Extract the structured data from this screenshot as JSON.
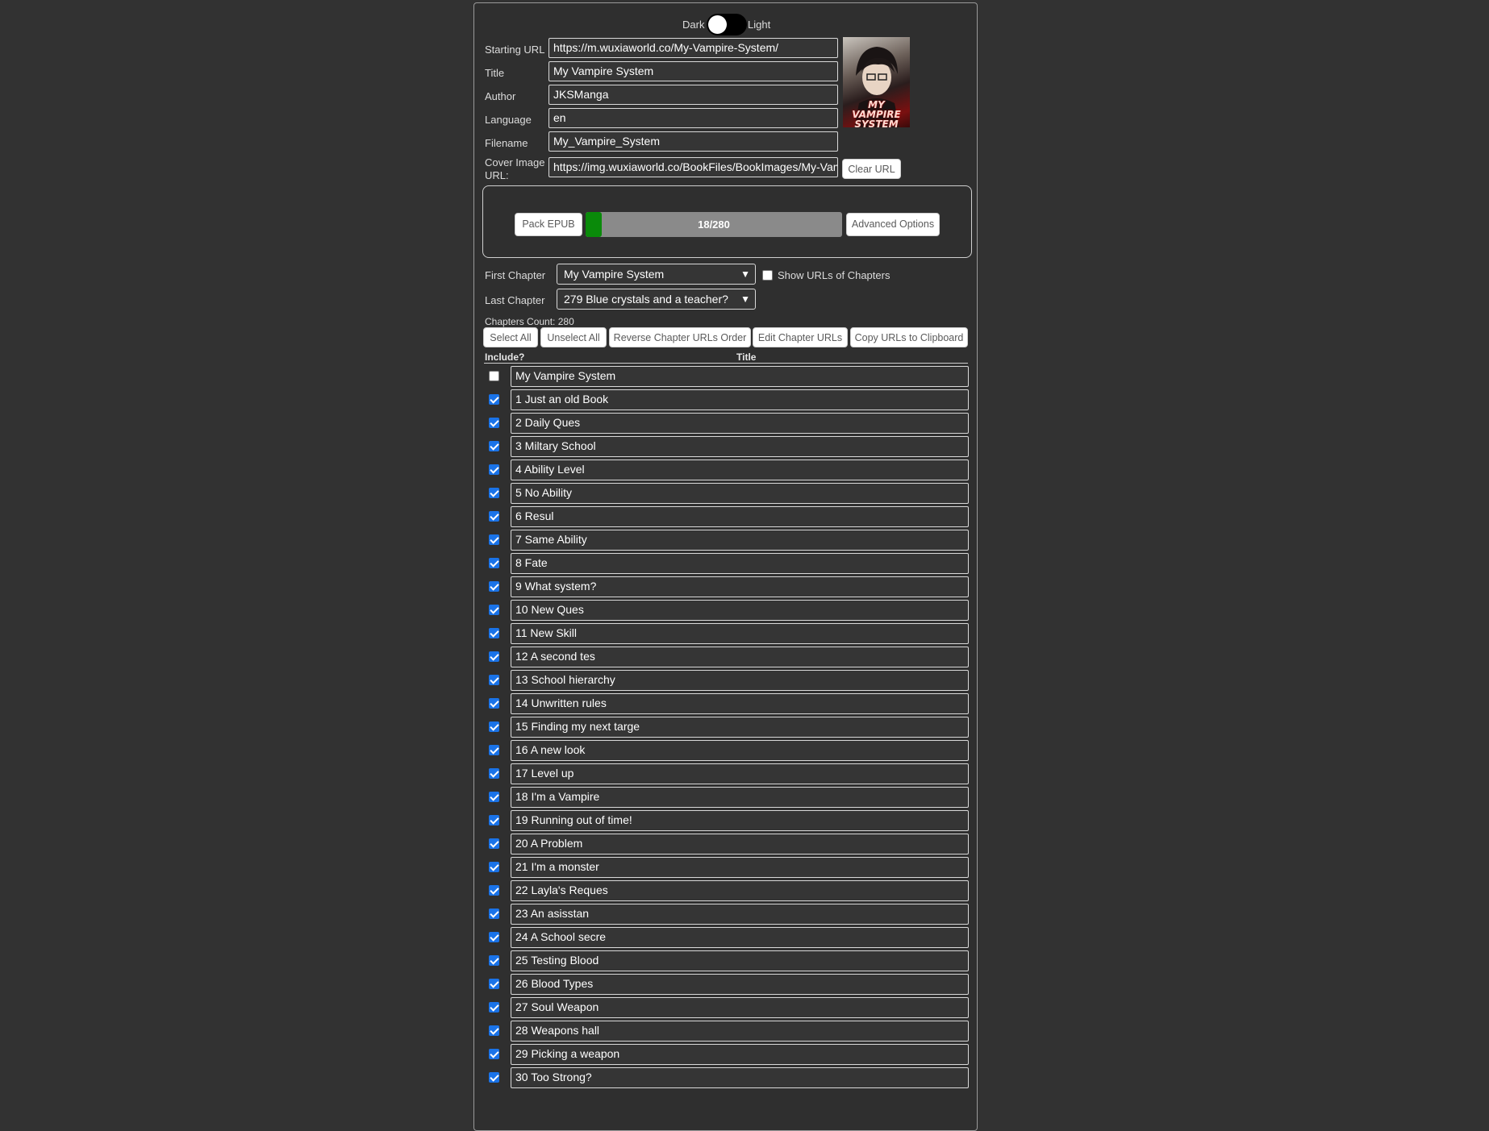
{
  "theme": {
    "dark_label": "Dark",
    "light_label": "Light"
  },
  "form": {
    "starting_url_label": "Starting URL",
    "starting_url": "https://m.wuxiaworld.co/My-Vampire-System/",
    "title_label": "Title",
    "title": "My Vampire System",
    "author_label": "Author",
    "author": "JKSManga",
    "language_label": "Language",
    "language": "en",
    "filename_label": "Filename",
    "filename": "My_Vampire_System",
    "cover_label_1": "Cover Image",
    "cover_label_2": "URL:",
    "cover_url": "https://img.wuxiaworld.co/BookFiles/BookImages/My-Vampire-System.jpg",
    "clear_url_label": "Clear URL",
    "cover_text": "MY VAMPIRE SYSTEM"
  },
  "pack": {
    "pack_label": "Pack EPUB",
    "progress_text": "18/280",
    "progress_value": 18,
    "progress_max": 280,
    "advanced_label": "Advanced Options",
    "progress_color": "#0a8a0a"
  },
  "chapters_cfg": {
    "first_label": "First Chapter",
    "first_value": "My Vampire System",
    "last_label": "Last Chapter",
    "last_value": "279 Blue crystals and a teacher?",
    "show_urls_label": "Show URLs of Chapters",
    "count_text": "Chapters Count: 280"
  },
  "actions": {
    "select_all": "Select All",
    "unselect_all": "Unselect All",
    "reverse": "Reverse Chapter URLs Order",
    "edit": "Edit Chapter URLs",
    "copy": "Copy URLs to Clipboard"
  },
  "table": {
    "include_header": "Include?",
    "title_header": "Title"
  },
  "chapters": [
    {
      "title": "My Vampire System",
      "checked": false
    },
    {
      "title": "1 Just an old Book",
      "checked": true
    },
    {
      "title": "2 Daily Ques",
      "checked": true
    },
    {
      "title": "3 Miltary School",
      "checked": true
    },
    {
      "title": "4 Ability Level",
      "checked": true
    },
    {
      "title": "5 No Ability",
      "checked": true
    },
    {
      "title": "6 Resul",
      "checked": true
    },
    {
      "title": "7 Same Ability",
      "checked": true
    },
    {
      "title": "8 Fate",
      "checked": true
    },
    {
      "title": "9 What system?",
      "checked": true
    },
    {
      "title": "10 New Ques",
      "checked": true
    },
    {
      "title": "11 New Skill",
      "checked": true
    },
    {
      "title": "12 A second tes",
      "checked": true
    },
    {
      "title": "13 School hierarchy",
      "checked": true
    },
    {
      "title": "14 Unwritten rules",
      "checked": true
    },
    {
      "title": "15 Finding my next targe",
      "checked": true
    },
    {
      "title": "16 A new look",
      "checked": true
    },
    {
      "title": "17 Level up",
      "checked": true
    },
    {
      "title": "18 I'm a Vampire",
      "checked": true
    },
    {
      "title": "19 Running out of time!",
      "checked": true
    },
    {
      "title": "20 A Problem",
      "checked": true
    },
    {
      "title": "21 I'm a monster",
      "checked": true
    },
    {
      "title": "22 Layla's Reques",
      "checked": true
    },
    {
      "title": "23 An asisstan",
      "checked": true
    },
    {
      "title": "24 A School secre",
      "checked": true
    },
    {
      "title": "25 Testing Blood",
      "checked": true
    },
    {
      "title": "26 Blood Types",
      "checked": true
    },
    {
      "title": "27 Soul Weapon",
      "checked": true
    },
    {
      "title": "28 Weapons hall",
      "checked": true
    },
    {
      "title": "29 Picking a weapon",
      "checked": true
    },
    {
      "title": "30 Too Strong?",
      "checked": true
    }
  ]
}
